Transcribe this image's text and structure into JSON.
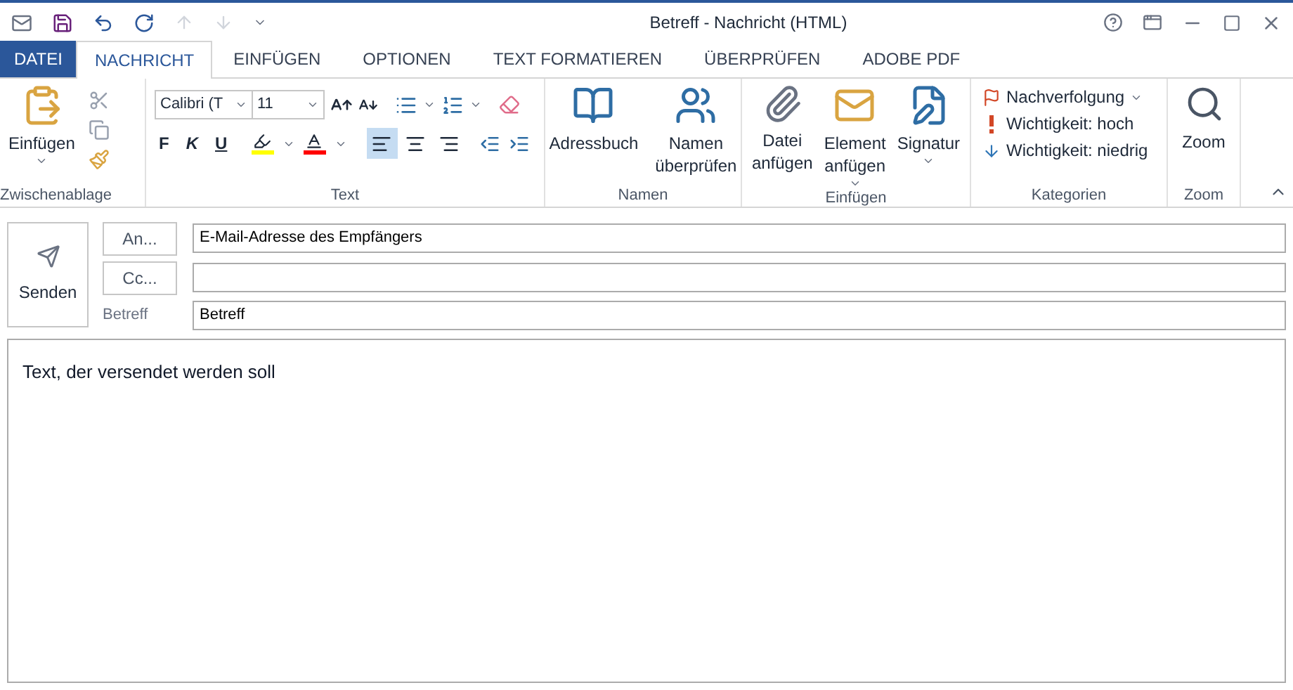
{
  "window": {
    "title": "Betreff - Nachricht (HTML)"
  },
  "tabs": [
    {
      "label": "DATEI",
      "kind": "file",
      "selected": false
    },
    {
      "label": "NACHRICHT",
      "kind": "tab",
      "selected": true
    },
    {
      "label": "EINFÜGEN",
      "kind": "tab",
      "selected": false
    },
    {
      "label": "OPTIONEN",
      "kind": "tab",
      "selected": false
    },
    {
      "label": "TEXT FORMATIEREN",
      "kind": "tab",
      "selected": false
    },
    {
      "label": "ÜBERPRÜFEN",
      "kind": "tab",
      "selected": false
    },
    {
      "label": "ADOBE PDF",
      "kind": "tab",
      "selected": false
    }
  ],
  "ribbon": {
    "clipboard": {
      "label": "Zwischenablage",
      "paste": "Einfügen"
    },
    "text": {
      "label": "Text",
      "font": "Calibri (T",
      "size": "11",
      "bold": "F",
      "italic": "K",
      "underline": "U",
      "align": [
        {
          "kind": "left",
          "selected": true
        },
        {
          "kind": "center",
          "selected": false
        },
        {
          "kind": "right",
          "selected": false
        }
      ]
    },
    "names": {
      "label": "Namen",
      "buttons": [
        {
          "kind": "book",
          "label": "Adressbuch"
        },
        {
          "kind": "people",
          "label": "Namen\nüberprüfen"
        }
      ]
    },
    "insert": {
      "label": "Einfügen",
      "buttons": [
        {
          "kind": "clip",
          "label": "Datei\nanfügen",
          "caret": false
        },
        {
          "kind": "envelope",
          "label": "Element\nanfügen",
          "caret": true
        },
        {
          "kind": "signature",
          "label": "Signatur",
          "caret": true
        }
      ]
    },
    "tags": {
      "label": "Kategorien",
      "items": [
        {
          "kind": "flag",
          "label": "Nachverfolgung",
          "caret": true
        },
        {
          "kind": "high",
          "label": "Wichtigkeit: hoch",
          "caret": false
        },
        {
          "kind": "low",
          "label": "Wichtigkeit: niedrig",
          "caret": false
        }
      ]
    },
    "zoom": {
      "label": "Zoom",
      "button": "Zoom"
    }
  },
  "compose": {
    "send": "Senden",
    "to_button": "An...",
    "to_value": "E-Mail-Adresse des Empfängers",
    "cc_button": "Cc...",
    "subject_label": "Betreff",
    "subject_value": "Betreff",
    "body": "Text, der versendet werden soll"
  }
}
